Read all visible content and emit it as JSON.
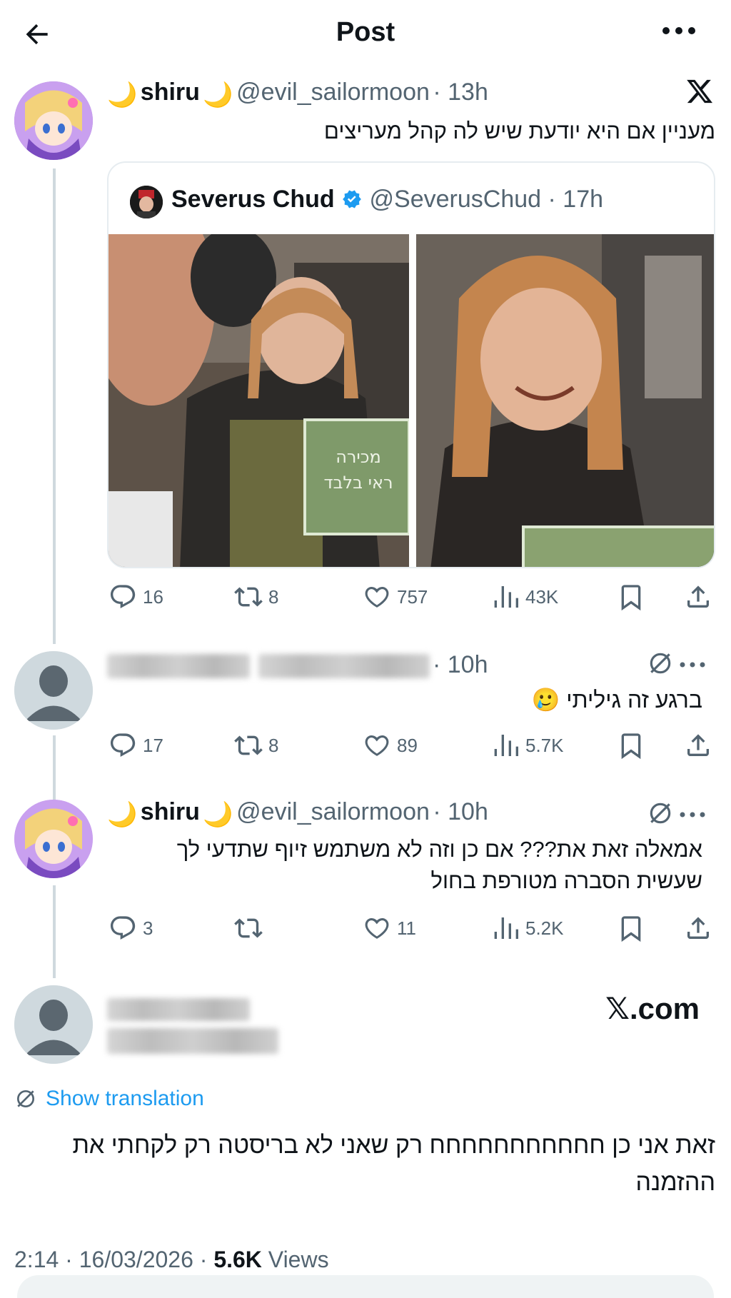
{
  "header": {
    "title": "Post"
  },
  "main_post": {
    "name": "shiru",
    "name_emoji_left": "🌙",
    "name_emoji_right": "🌙",
    "handle": "@evil_sailormoon",
    "time": "· 13h",
    "text": "מעניין אם היא יודעת שיש לה קהל מעריצים",
    "quote": {
      "name": "Severus Chud",
      "handle": "@SeverusChud",
      "time": "· 17h",
      "sign_text_line1": "מכירה",
      "sign_text_line2": "ראי בלבד"
    },
    "stats": {
      "replies": "16",
      "reposts": "8",
      "likes": "757",
      "views": "43K"
    }
  },
  "reply1": {
    "time": "· 10h",
    "text": "ברגע זה גיליתי",
    "emoji": "🥲",
    "stats": {
      "replies": "17",
      "reposts": "8",
      "likes": "89",
      "views": "5.7K"
    }
  },
  "reply2": {
    "name": "shiru",
    "name_emoji_left": "🌙",
    "name_emoji_right": "🌙",
    "handle": "@evil_sailormoon",
    "time": "· 10h",
    "text_line1": "אמאלה זאת את??? אם כן וזה לא משתמש זיוף שתדעי לך",
    "text_line2": "שעשית הסברה מטורפת בחול",
    "stats": {
      "replies": "3",
      "reposts": "",
      "likes": "11",
      "views": "5.2K"
    }
  },
  "focused_reply": {
    "watermark": "𝕏.com",
    "show_translation": "Show translation",
    "text_line1": "זאת אני כן חחחחחחחחחחח רק שאני לא בריסטה רק לקחתי את",
    "text_line2": "ההזמנה",
    "time": "2:14 · 16/03/2026 ·",
    "views_count": "5.6K",
    "views_label": "Views"
  },
  "colors": {
    "text": "#0f1419",
    "secondary": "#536471",
    "link": "#1d9bf0",
    "line": "#cfd9de",
    "verified": "#1d9bf0"
  },
  "icons": [
    "arrow-left-icon",
    "more-icon",
    "x-logo-icon",
    "reply-icon",
    "repost-icon",
    "like-icon",
    "views-icon",
    "bookmark-icon",
    "share-icon",
    "translate-icon",
    "verified-icon"
  ]
}
